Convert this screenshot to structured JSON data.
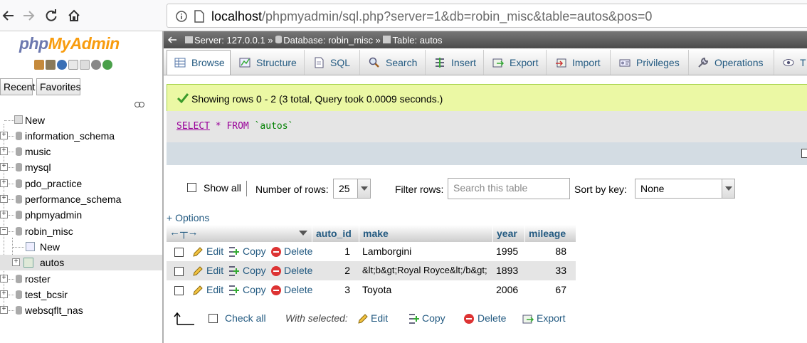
{
  "browser": {
    "url_host": "localhost",
    "url_path": "/phpmyadmin/sql.php?server=1&db=robin_misc&table=autos&pos=0"
  },
  "sidebar": {
    "logo_php": "php",
    "logo_myadmin": "MyAdmin",
    "tab_recent": "Recent",
    "tab_favorites": "Favorites",
    "tree": [
      {
        "label": "New"
      },
      {
        "label": "information_schema"
      },
      {
        "label": "music"
      },
      {
        "label": "mysql"
      },
      {
        "label": "pdo_practice"
      },
      {
        "label": "performance_schema"
      },
      {
        "label": "phpmyadmin"
      },
      {
        "label": "robin_misc"
      },
      {
        "label": "New"
      },
      {
        "label": "autos"
      },
      {
        "label": "roster"
      },
      {
        "label": "test_bcsir"
      },
      {
        "label": "websqflt_nas"
      }
    ]
  },
  "breadcrumb": {
    "server": "Server: 127.0.0.1",
    "database": "Database: robin_misc",
    "table": "Table: autos",
    "separator": "»"
  },
  "tabs": [
    {
      "label": "Browse"
    },
    {
      "label": "Structure"
    },
    {
      "label": "SQL"
    },
    {
      "label": "Search"
    },
    {
      "label": "Insert"
    },
    {
      "label": "Export"
    },
    {
      "label": "Import"
    },
    {
      "label": "Privileges"
    },
    {
      "label": "Operations"
    },
    {
      "label": "T"
    }
  ],
  "message": "Showing rows 0 - 2 (3 total, Query took 0.0009 seconds.)",
  "query": {
    "select": "SELECT",
    "star": "*",
    "from": "FROM",
    "table": "`autos`"
  },
  "navigation": {
    "show_all": "Show all",
    "rows_label": "Number of rows:",
    "rows_value": "25",
    "filter_label": "Filter rows:",
    "filter_placeholder": "Search this table",
    "sort_label": "Sort by key:",
    "sort_value": "None"
  },
  "options_link": "+ Options",
  "table": {
    "columns": [
      "auto_id",
      "make",
      "year",
      "mileage"
    ],
    "actions": {
      "edit": "Edit",
      "copy": "Copy",
      "delete": "Delete"
    },
    "rows": [
      {
        "auto_id": "1",
        "make": "Lamborgini",
        "year": "1995",
        "mileage": "88"
      },
      {
        "auto_id": "2",
        "make": "&lt;b&gt;Royal Royce&lt;/b&gt;",
        "year": "1893",
        "mileage": "33"
      },
      {
        "auto_id": "3",
        "make": "Toyota",
        "year": "2006",
        "mileage": "67"
      }
    ]
  },
  "footer": {
    "check_all": "Check all",
    "with_selected": "With selected:",
    "edit": "Edit",
    "copy": "Copy",
    "delete": "Delete",
    "export": "Export"
  },
  "colors": {
    "link": "#235a81",
    "success_bg": "#ebf8a4",
    "sql_keyword": "#990099"
  }
}
